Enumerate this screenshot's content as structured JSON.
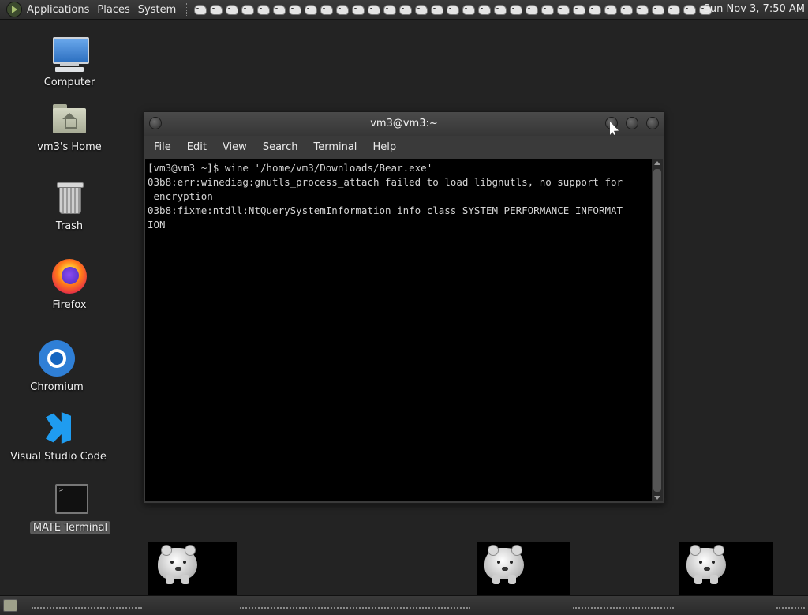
{
  "top_panel": {
    "menus": [
      "Applications",
      "Places",
      "System"
    ],
    "launcher_icon": "polar-bear-icon",
    "clock": "Sun Nov 3,  7:50 AM"
  },
  "desktop": {
    "icons": [
      {
        "label": "Computer",
        "icon": "computer-icon"
      },
      {
        "label": "vm3's Home",
        "icon": "home-folder-icon"
      },
      {
        "label": "Trash",
        "icon": "trash-icon"
      },
      {
        "label": "Firefox",
        "icon": "firefox-icon"
      },
      {
        "label": "Chromium",
        "icon": "chromium-icon"
      },
      {
        "label": "Visual Studio Code",
        "icon": "vscode-icon"
      },
      {
        "label": "MATE Terminal",
        "icon": "terminal-icon",
        "selected": true
      }
    ]
  },
  "terminal": {
    "title": "vm3@vm3:~",
    "menu": [
      "File",
      "Edit",
      "View",
      "Search",
      "Terminal",
      "Help"
    ],
    "output": "[vm3@vm3 ~]$ wine '/home/vm3/Downloads/Bear.exe'\n03b8:err:winediag:gnutls_process_attach failed to load libgnutls, no support for\n encryption\n03b8:fixme:ntdll:NtQuerySystemInformation info_class SYSTEM_PERFORMANCE_INFORMAT\nION"
  },
  "bottom_panel": {
    "show_desktop_icon": "show-desktop-icon"
  },
  "bear_windows": [
    "polar-bear-icon",
    "polar-bear-icon",
    "polar-bear-icon"
  ],
  "colors": {
    "desktop_bg": "#232323",
    "panel_bg": "#2f2f2f",
    "terminal_bg": "#000000",
    "terminal_fg": "#d4d4d4",
    "window_frame": "#3a3a3a"
  }
}
